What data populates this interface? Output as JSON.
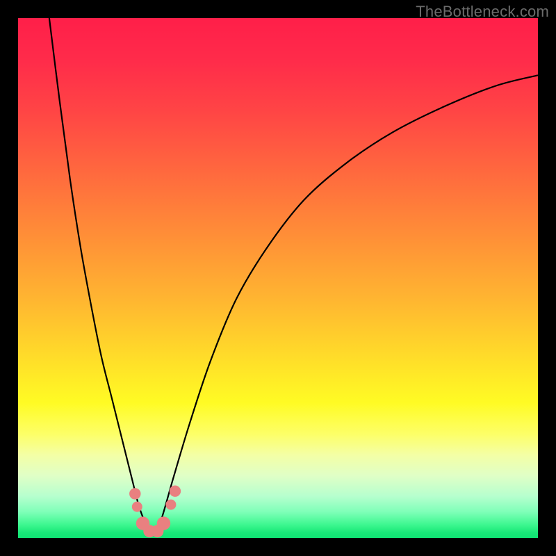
{
  "watermark": "TheBottleneck.com",
  "colors": {
    "background": "#000000",
    "gradient_top": "#ff1f49",
    "gradient_bottom": "#0fe474",
    "curve": "#000000",
    "bead": "#e98080"
  },
  "chart_data": {
    "type": "line",
    "title": "",
    "xlabel": "",
    "ylabel": "",
    "xlim": [
      0,
      100
    ],
    "ylim": [
      0,
      100
    ],
    "note": "Axes are unlabeled percentages; background is a vertical heat gradient from red (high, top) to green (low, bottom). The two curves form a V-shaped notch indicating minimum bottleneck near x≈25.",
    "series": [
      {
        "name": "left-arm",
        "x": [
          6,
          8,
          10,
          12,
          14,
          16,
          18,
          20,
          22,
          23,
          24,
          25,
          26
        ],
        "y": [
          100,
          84,
          69,
          56,
          45,
          35,
          27,
          19,
          11,
          7,
          4,
          2,
          1
        ]
      },
      {
        "name": "right-arm",
        "x": [
          26,
          27,
          28,
          30,
          33,
          37,
          42,
          48,
          55,
          63,
          72,
          82,
          92,
          100
        ],
        "y": [
          1,
          2,
          5,
          12,
          22,
          34,
          46,
          56,
          65,
          72,
          78,
          83,
          87,
          89
        ]
      }
    ],
    "markers": [
      {
        "x": 22.5,
        "y": 8.5,
        "r": 1.1
      },
      {
        "x": 22.9,
        "y": 6.0,
        "r": 1.0
      },
      {
        "x": 24.0,
        "y": 2.8,
        "r": 1.3
      },
      {
        "x": 25.3,
        "y": 1.3,
        "r": 1.2
      },
      {
        "x": 26.8,
        "y": 1.3,
        "r": 1.2
      },
      {
        "x": 28.0,
        "y": 2.8,
        "r": 1.3
      },
      {
        "x": 29.4,
        "y": 6.4,
        "r": 1.0
      },
      {
        "x": 30.2,
        "y": 9.0,
        "r": 1.1
      }
    ]
  }
}
